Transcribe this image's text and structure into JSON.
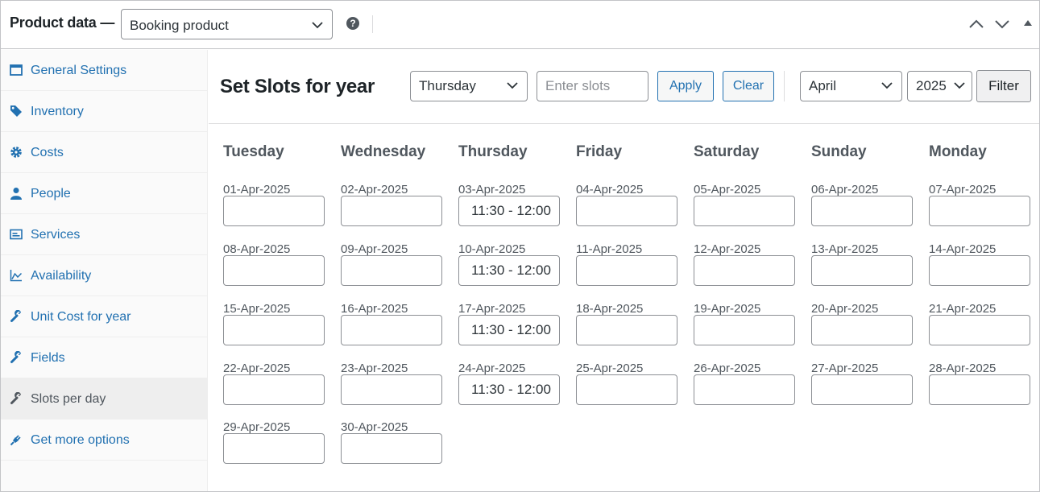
{
  "header": {
    "title": "Product data —",
    "product_type": "Booking product"
  },
  "sidebar": {
    "items": [
      {
        "label": "General Settings",
        "icon": "window-icon",
        "active": false
      },
      {
        "label": "Inventory",
        "icon": "tag-icon",
        "active": false
      },
      {
        "label": "Costs",
        "icon": "gear-icon",
        "active": false
      },
      {
        "label": "People",
        "icon": "person-icon",
        "active": false
      },
      {
        "label": "Services",
        "icon": "card-icon",
        "active": false
      },
      {
        "label": "Availability",
        "icon": "chart-icon",
        "active": false
      },
      {
        "label": "Unit Cost for year",
        "icon": "wrench-icon",
        "active": false
      },
      {
        "label": "Fields",
        "icon": "wrench-icon",
        "active": false
      },
      {
        "label": "Slots per day",
        "icon": "wrench-icon",
        "active": true
      },
      {
        "label": "Get more options",
        "icon": "plug-icon",
        "active": false
      }
    ]
  },
  "toolbar": {
    "title": "Set Slots for year",
    "day_select": "Thursday",
    "slots_placeholder": "Enter slots",
    "apply_label": "Apply",
    "clear_label": "Clear",
    "month_select": "April",
    "year_select": "2025",
    "filter_label": "Filter"
  },
  "calendar": {
    "days": [
      "Tuesday",
      "Wednesday",
      "Thursday",
      "Friday",
      "Saturday",
      "Sunday",
      "Monday"
    ],
    "rows": [
      [
        {
          "date": "01-Apr-2025",
          "value": ""
        },
        {
          "date": "02-Apr-2025",
          "value": ""
        },
        {
          "date": "03-Apr-2025",
          "value": "11:30 - 12:00"
        },
        {
          "date": "04-Apr-2025",
          "value": ""
        },
        {
          "date": "05-Apr-2025",
          "value": ""
        },
        {
          "date": "06-Apr-2025",
          "value": ""
        },
        {
          "date": "07-Apr-2025",
          "value": ""
        }
      ],
      [
        {
          "date": "08-Apr-2025",
          "value": ""
        },
        {
          "date": "09-Apr-2025",
          "value": ""
        },
        {
          "date": "10-Apr-2025",
          "value": "11:30 - 12:00"
        },
        {
          "date": "11-Apr-2025",
          "value": ""
        },
        {
          "date": "12-Apr-2025",
          "value": ""
        },
        {
          "date": "13-Apr-2025",
          "value": ""
        },
        {
          "date": "14-Apr-2025",
          "value": ""
        }
      ],
      [
        {
          "date": "15-Apr-2025",
          "value": ""
        },
        {
          "date": "16-Apr-2025",
          "value": ""
        },
        {
          "date": "17-Apr-2025",
          "value": "11:30 - 12:00"
        },
        {
          "date": "18-Apr-2025",
          "value": ""
        },
        {
          "date": "19-Apr-2025",
          "value": ""
        },
        {
          "date": "20-Apr-2025",
          "value": ""
        },
        {
          "date": "21-Apr-2025",
          "value": ""
        }
      ],
      [
        {
          "date": "22-Apr-2025",
          "value": ""
        },
        {
          "date": "23-Apr-2025",
          "value": ""
        },
        {
          "date": "24-Apr-2025",
          "value": "11:30 - 12:00"
        },
        {
          "date": "25-Apr-2025",
          "value": ""
        },
        {
          "date": "26-Apr-2025",
          "value": ""
        },
        {
          "date": "27-Apr-2025",
          "value": ""
        },
        {
          "date": "28-Apr-2025",
          "value": ""
        }
      ],
      [
        {
          "date": "29-Apr-2025",
          "value": ""
        },
        {
          "date": "30-Apr-2025",
          "value": ""
        }
      ]
    ]
  }
}
